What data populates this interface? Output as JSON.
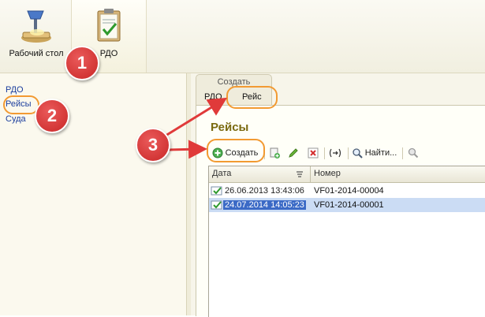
{
  "sections": [
    {
      "label": "Рабочий стол",
      "icon": "desktop-lamp-icon"
    },
    {
      "label": "РДО",
      "icon": "clipboard-check-icon"
    }
  ],
  "nav": [
    "РДО",
    "Рейсы",
    "Суда"
  ],
  "create_panel": {
    "title": "Создать",
    "tabs": [
      "РДО",
      "Рейс"
    ]
  },
  "form": {
    "title": "Рейсы",
    "toolbar": {
      "create_label": "Создать",
      "find_label": "Найти..."
    },
    "columns": [
      "Дата",
      "Номер"
    ],
    "rows": [
      {
        "date": "26.06.2013 13:43:06",
        "number": "VF01-2014-00004",
        "selected": false
      },
      {
        "date": "24.07.2014 14:05:23",
        "number": "VF01-2014-00001",
        "selected": true
      }
    ]
  },
  "annotations": {
    "badges": [
      "1",
      "2",
      "3"
    ],
    "color": "#f29a32",
    "badge_color": "#d63030"
  },
  "colors": {
    "title": "#7a6a10",
    "link": "#1c3f9e",
    "selection": "#3b6ac6"
  }
}
